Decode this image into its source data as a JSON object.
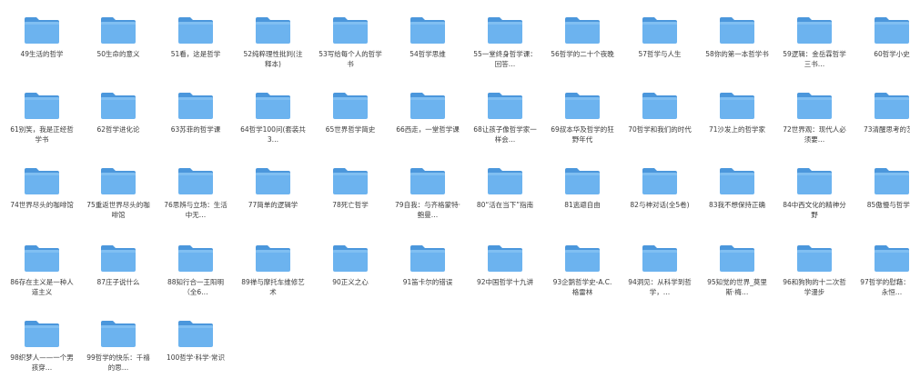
{
  "folder_icon": "folder-icon",
  "folder_color": "#5aa6e6",
  "folders": [
    "49生活的哲学",
    "50生命的意义",
    "51看，这是哲学",
    "52纯粹理性批判(注释本)",
    "53写给每个人的哲学书",
    "54哲学思维",
    "55一堂终身哲学课：回答…",
    "56哲学的二十个夜晚",
    "57哲学与人生",
    "58你的第一本哲学书",
    "59逻辑：金岳霖哲学三书…",
    "60哲学小史",
    "61别笑，我是正经哲学书",
    "62哲学进化论",
    "63苏菲的哲学课",
    "64哲学100问(套装共3…",
    "65世界哲学简史",
    "66西走，一堂哲学课",
    "68让孩子像哲学家一样会…",
    "69叔本华及哲学的狂野年代",
    "70哲学和我们的时代",
    "71沙发上的哲学家",
    "72世界观：现代人必须要…",
    "73清醒思考的艺术",
    "74世界尽头的咖啡馆",
    "75重返世界尽头的咖啡馆",
    "76思辨与立场：生活中无…",
    "77简单的逻辑学",
    "78死亡哲学",
    "79自我：与齐格蒙特·鲍曼…",
    "80“活在当下”指南",
    "81逃避自由",
    "82与神对话(全5卷)",
    "83我不想保持正确",
    "84中西文化的精神分野",
    "85傲慢与哲学家",
    "86存在主义是一种人道主义",
    "87庄子说什么",
    "88知行合一王阳明（全6…",
    "89禅与摩托车维修艺术",
    "90正义之心",
    "91笛卡尔的错误",
    "92中国哲学十九讲",
    "93企鹅哲学史-A.C.格雷林",
    "94洞见：从科学到哲学，…",
    "95知觉的世界_莫里斯·梅…",
    "96和狗狗的十二次哲学漫步",
    "97哲学的慰藉：人类永恒…",
    "98织梦人——一个男孩穿…",
    "99哲学的快乐：千禧的思…",
    "100哲学·科学·常识"
  ]
}
